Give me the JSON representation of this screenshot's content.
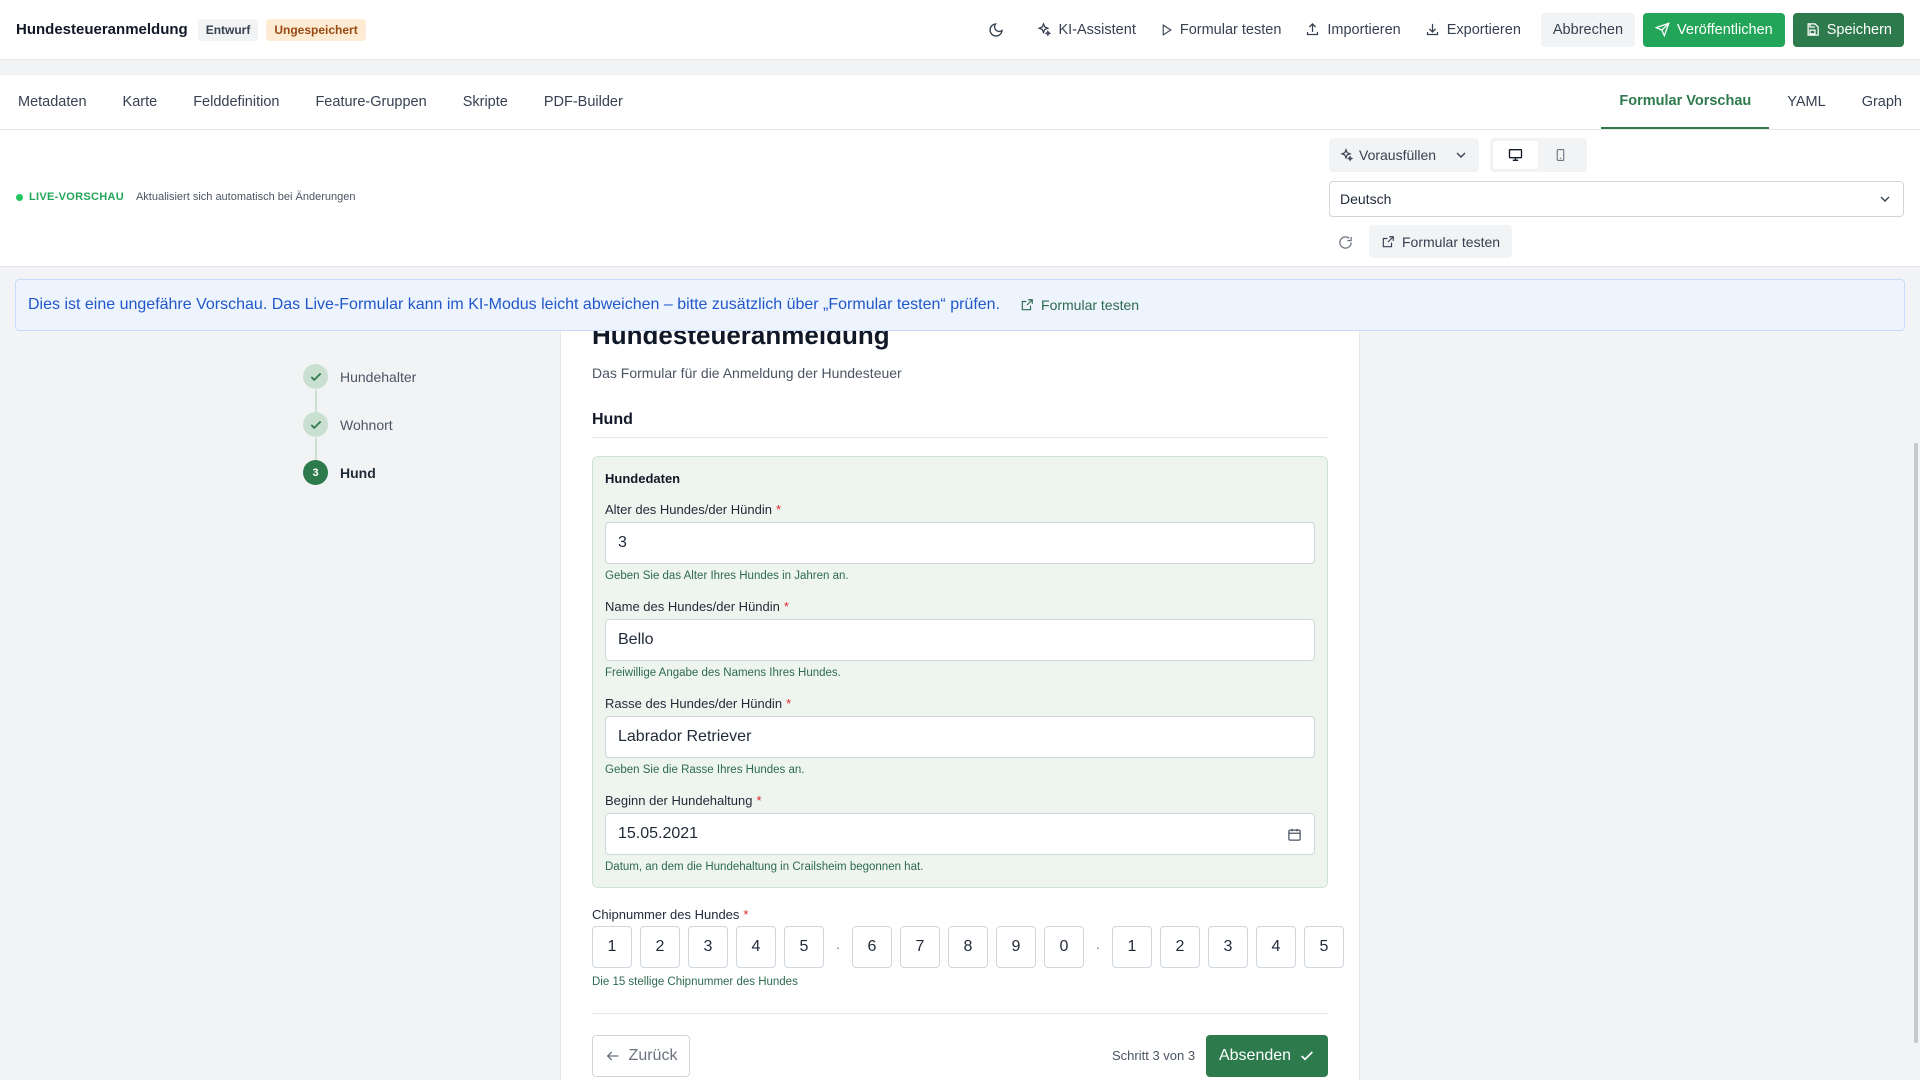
{
  "header": {
    "title": "Hundesteueranmeldung",
    "badge_draft": "Entwurf",
    "badge_unsaved": "Ungespeichert",
    "ki_assistent": "KI-Assistent",
    "formular_testen": "Formular testen",
    "importieren": "Importieren",
    "exportieren": "Exportieren",
    "abbrechen": "Abbrechen",
    "veroeffentlichen": "Veröffentlichen",
    "speichern": "Speichern"
  },
  "tabs": {
    "left": [
      "Metadaten",
      "Karte",
      "Felddefinition",
      "Feature-Gruppen",
      "Skripte",
      "PDF-Builder"
    ],
    "right": [
      "Formular Vorschau",
      "YAML",
      "Graph"
    ],
    "active": "Formular Vorschau"
  },
  "preview": {
    "live_label": "LIVE-VORSCHAU",
    "live_desc": "Aktualisiert sich automatisch bei Änderungen",
    "prefill_label": "Vorausfüllen",
    "language": "Deutsch",
    "test_button": "Formular testen"
  },
  "banner": {
    "text": "Dies ist eine ungefähre Vorschau. Das Live-Formular kann im KI-Modus leicht abweichen – bitte zusätzlich über „Formular testen“ prüfen.",
    "link": "Formular testen"
  },
  "stepper": {
    "steps": [
      {
        "label": "Hundehalter",
        "state": "done"
      },
      {
        "label": "Wohnort",
        "state": "done"
      },
      {
        "label": "Hund",
        "state": "current",
        "number": "3"
      }
    ]
  },
  "form": {
    "title": "Hundesteueranmeldung",
    "subtitle": "Das Formular für die Anmeldung der Hundesteuer",
    "section": "Hund",
    "group_title": "Hundedaten",
    "fields": [
      {
        "label": "Alter des Hundes/der Hündin",
        "required": "*",
        "value": "3",
        "help": "Geben Sie das Alter Ihres Hundes in Jahren an."
      },
      {
        "label": "Name des Hundes/der Hündin",
        "required": "*",
        "value": "Bello",
        "help": "Freiwillige Angabe des Namens Ihres Hundes."
      },
      {
        "label": "Rasse des Hundes/der Hündin",
        "required": "*",
        "value": "Labrador Retriever",
        "help": "Geben Sie die Rasse Ihres Hundes an."
      },
      {
        "label": "Beginn der Hundehaltung",
        "required": "*",
        "value": "15.05.2021",
        "help": "Datum, an dem die Hundehaltung in Crailsheim begonnen hat."
      }
    ],
    "chip": {
      "label": "Chipnummer des Hundes",
      "required": "*",
      "digits": [
        "1",
        "2",
        "3",
        "4",
        "5",
        "6",
        "7",
        "8",
        "9",
        "0",
        "1",
        "2",
        "3",
        "4",
        "5"
      ],
      "separator": "·",
      "help": "Die 15 stellige Chipnummer des Hundes"
    },
    "back": "Zurück",
    "step_info": "Schritt 3 von 3",
    "submit": "Absenden"
  },
  "colors": {
    "primary_green": "#2d7a4c",
    "publish_green": "#22a559",
    "info_blue": "#2158c9"
  }
}
